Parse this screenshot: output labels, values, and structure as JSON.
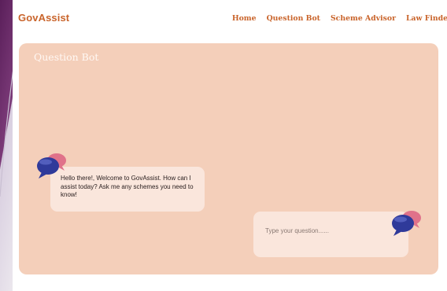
{
  "navbar": {
    "brand": "GovAssist",
    "links": [
      "Home",
      "Question Bot",
      "Scheme Advisor",
      "Law Finder"
    ]
  },
  "chat": {
    "title": "Question Bot",
    "bot_message": "Hello there!, Welcome to GovAssist. How can I assist today? Ask me any schemes you need to know!",
    "input_placeholder": "Type your question......",
    "input_value": ""
  },
  "icons": {
    "bot_avatar": "chat-bubbles-icon",
    "user_avatar": "chat-bubbles-icon"
  },
  "colors": {
    "brand": "#c9642b",
    "panel_bg": "#f4cfba",
    "bubble_bg": "#fae6dc",
    "icon_front": "#2f3a9a",
    "icon_back": "#e0728a"
  }
}
